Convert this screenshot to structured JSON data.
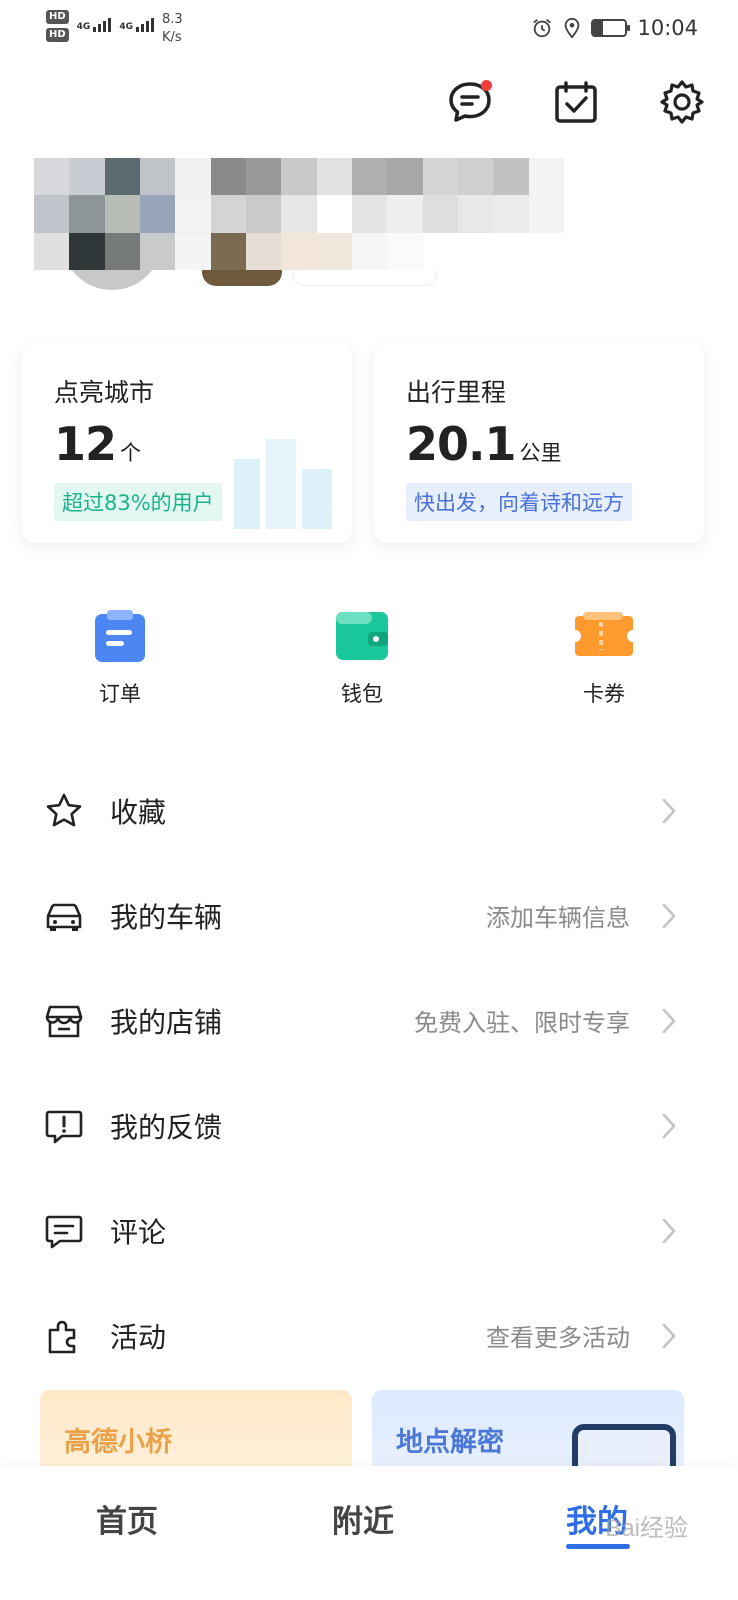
{
  "status_bar": {
    "sim1": "HD",
    "sim2": "HD",
    "net1": "4G",
    "net2": "4G",
    "speed_value": "8.3",
    "speed_unit": "K/s",
    "time": "10:04",
    "battery_level": 0.3
  },
  "stats": {
    "cities": {
      "label": "点亮城市",
      "value": "12",
      "unit": "个",
      "tag": "超过83%的用户"
    },
    "mileage": {
      "label": "出行里程",
      "value": "20.1",
      "unit": "公里",
      "tag": "快出发，向着诗和远方"
    }
  },
  "quick_actions": [
    {
      "label": "订单",
      "icon": "clipboard-icon",
      "color": "#4b86f2"
    },
    {
      "label": "钱包",
      "icon": "wallet-icon",
      "color": "#19c79b"
    },
    {
      "label": "卡券",
      "icon": "ticket-icon",
      "color": "#ff9a2e"
    }
  ],
  "menu": [
    {
      "label": "收藏",
      "hint": "",
      "icon": "star-icon"
    },
    {
      "label": "我的车辆",
      "hint": "添加车辆信息",
      "icon": "car-icon"
    },
    {
      "label": "我的店铺",
      "hint": "免费入驻、限时专享",
      "icon": "store-icon"
    },
    {
      "label": "我的反馈",
      "hint": "",
      "icon": "feedback-icon"
    },
    {
      "label": "评论",
      "hint": "",
      "icon": "comment-icon"
    },
    {
      "label": "活动",
      "hint": "查看更多活动",
      "icon": "puzzle-icon"
    }
  ],
  "promos": [
    {
      "title": "高德小桥"
    },
    {
      "title": "地点解密"
    }
  ],
  "tabs": {
    "home": "首页",
    "nearby": "附近",
    "me": "我的",
    "active": "me"
  },
  "colors": {
    "accent": "#2f6ee6",
    "notification_dot": "#f23d3d"
  },
  "watermark": "Bai经验"
}
